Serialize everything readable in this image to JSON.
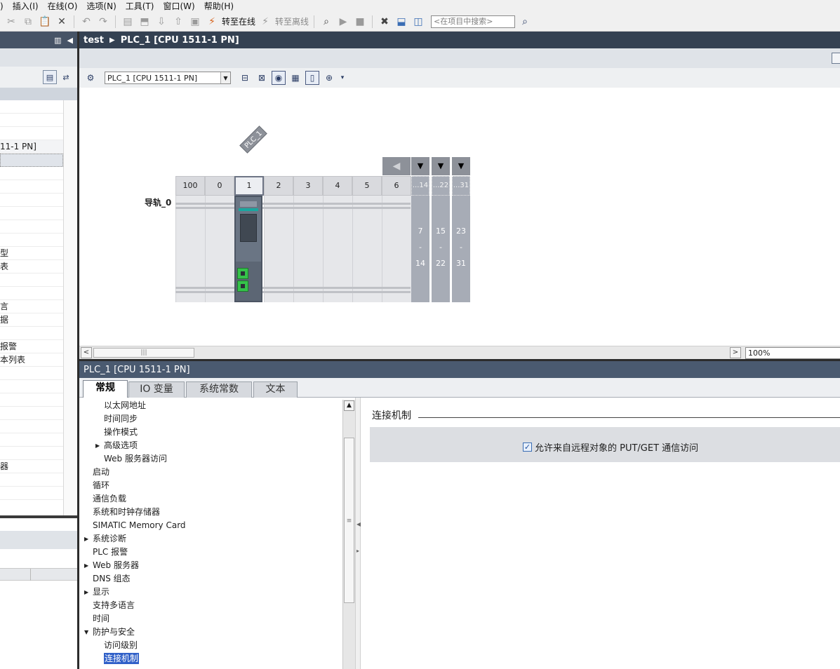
{
  "menu": [
    ")",
    "插入(I)",
    "在线(O)",
    "选项(N)",
    "工具(T)",
    "窗口(W)",
    "帮助(H)"
  ],
  "toolbar": {
    "go_online_label": "转至在线",
    "go_offline_label": "转至离线",
    "search_placeholder": "<在项目中搜索>"
  },
  "project_tree": {
    "rows": [
      "",
      "",
      "",
      "11-1 PN]",
      "",
      "",
      "",
      "",
      "",
      "",
      "",
      "型",
      "表",
      "",
      "",
      "言",
      "据",
      "",
      "报警",
      "本列表",
      "",
      "",
      "",
      "",
      "",
      "",
      "",
      "器",
      "",
      ""
    ]
  },
  "editor": {
    "breadcrumb": [
      "test",
      "PLC_1 [CPU 1511-1 PN]"
    ],
    "device_select": "PLC_1 [CPU 1511-1 PN]",
    "plc_tag": "PLC_1",
    "rack_label": "导轨_0",
    "slots": [
      "100",
      "0",
      "1",
      "2",
      "3",
      "4",
      "5",
      "6"
    ],
    "ext_heads": [
      "...14",
      "...22",
      "...31"
    ],
    "ext_groups": [
      {
        "from": "7",
        "dash": "-",
        "to": "14"
      },
      {
        "from": "15",
        "dash": "-",
        "to": "22"
      },
      {
        "from": "23",
        "dash": "-",
        "to": "31"
      }
    ],
    "zoom": "100%"
  },
  "inspector": {
    "title": "PLC_1 [CPU 1511-1 PN]",
    "tabs": [
      "常规",
      "IO 变量",
      "系统常数",
      "文本"
    ],
    "nav": [
      {
        "label": "以太网地址",
        "level": 2
      },
      {
        "label": "时间同步",
        "level": 2
      },
      {
        "label": "操作模式",
        "level": 2
      },
      {
        "label": "高级选项",
        "level": 2,
        "expand": "right"
      },
      {
        "label": "Web 服务器访问",
        "level": 2
      },
      {
        "label": "启动",
        "level": 1
      },
      {
        "label": "循环",
        "level": 1
      },
      {
        "label": "通信负载",
        "level": 1
      },
      {
        "label": "系统和时钟存储器",
        "level": 1
      },
      {
        "label": "SIMATIC Memory Card",
        "level": 1
      },
      {
        "label": "系统诊断",
        "level": 1,
        "expand": "right"
      },
      {
        "label": "PLC 报警",
        "level": 1
      },
      {
        "label": "Web 服务器",
        "level": 1,
        "expand": "right"
      },
      {
        "label": "DNS 组态",
        "level": 1
      },
      {
        "label": "显示",
        "level": 1,
        "expand": "right"
      },
      {
        "label": "支持多语言",
        "level": 1
      },
      {
        "label": "时间",
        "level": 1
      },
      {
        "label": "防护与安全",
        "level": 1,
        "expand": "down"
      },
      {
        "label": "访问级别",
        "level": 2
      },
      {
        "label": "连接机制",
        "level": 2,
        "selected": true
      }
    ],
    "section_title": "连接机制",
    "checkbox_label": "允许来自远程对象的 PUT/GET 通信访问",
    "checkbox_checked": true
  }
}
